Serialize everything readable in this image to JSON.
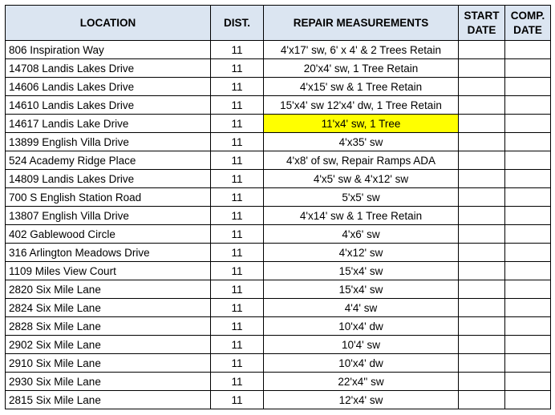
{
  "headers": {
    "location": "LOCATION",
    "dist": "DIST.",
    "repair": "REPAIR MEASUREMENTS",
    "start_line1": "START",
    "start_line2": "DATE",
    "comp_line1": "COMP.",
    "comp_line2": "DATE"
  },
  "highlight_color": "#ffff00",
  "header_fill_color": "#dbe5f1",
  "rows": [
    {
      "location": "806 Inspiration Way",
      "dist": "11",
      "repair": "4'x17' sw, 6' x 4' & 2 Trees Retain",
      "start": "",
      "comp": ""
    },
    {
      "location": "14708 Landis Lakes Drive",
      "dist": "11",
      "repair": "20'x4' sw, 1 Tree Retain",
      "start": "",
      "comp": ""
    },
    {
      "location": "14606 Landis Lakes Drive",
      "dist": "11",
      "repair": "4'x15' sw & 1 Tree Retain",
      "start": "",
      "comp": ""
    },
    {
      "location": "14610 Landis Lakes Drive",
      "dist": "11",
      "repair": "15'x4' sw 12'x4' dw, 1 Tree Retain",
      "start": "",
      "comp": ""
    },
    {
      "location": "14617 Landis Lake Drive",
      "dist": "11",
      "repair": "11'x4' sw, 1 Tree",
      "start": "",
      "comp": "",
      "highlight": true
    },
    {
      "location": "13899 English Villa Drive",
      "dist": "11",
      "repair": "4'x35' sw",
      "start": "",
      "comp": ""
    },
    {
      "location": "524 Academy Ridge Place",
      "dist": "11",
      "repair": "4'x8' of sw, Repair Ramps ADA",
      "start": "",
      "comp": ""
    },
    {
      "location": "14809 Landis Lakes Drive",
      "dist": "11",
      "repair": "4'x5' sw & 4'x12' sw",
      "start": "",
      "comp": ""
    },
    {
      "location": "700 S English Station Road",
      "dist": "11",
      "repair": "5'x5' sw",
      "start": "",
      "comp": ""
    },
    {
      "location": "13807 English Villa Drive",
      "dist": "11",
      "repair": "4'x14' sw & 1 Tree Retain",
      "start": "",
      "comp": ""
    },
    {
      "location": "402 Gablewood Circle",
      "dist": "11",
      "repair": "4'x6' sw",
      "start": "",
      "comp": ""
    },
    {
      "location": "316 Arlington Meadows Drive",
      "dist": "11",
      "repair": "4'x12' sw",
      "start": "",
      "comp": ""
    },
    {
      "location": "1109 Miles View Court",
      "dist": "11",
      "repair": "15'x4' sw",
      "start": "",
      "comp": ""
    },
    {
      "location": "2820 Six Mile Lane",
      "dist": "11",
      "repair": "15'x4' sw",
      "start": "",
      "comp": ""
    },
    {
      "location": "2824 Six Mile Lane",
      "dist": "11",
      "repair": "4'4' sw",
      "start": "",
      "comp": ""
    },
    {
      "location": "2828 Six Mile Lane",
      "dist": "11",
      "repair": "10'x4' dw",
      "start": "",
      "comp": ""
    },
    {
      "location": "2902 Six Mile Lane",
      "dist": "11",
      "repair": "10'4' sw",
      "start": "",
      "comp": ""
    },
    {
      "location": "2910 Six Mile Lane",
      "dist": "11",
      "repair": "10'x4' dw",
      "start": "",
      "comp": ""
    },
    {
      "location": "2930 Six Mile Lane",
      "dist": "11",
      "repair": "22'x4'' sw",
      "start": "",
      "comp": ""
    },
    {
      "location": "2815 Six Mile Lane",
      "dist": "11",
      "repair": "12'x4' sw",
      "start": "",
      "comp": ""
    }
  ]
}
